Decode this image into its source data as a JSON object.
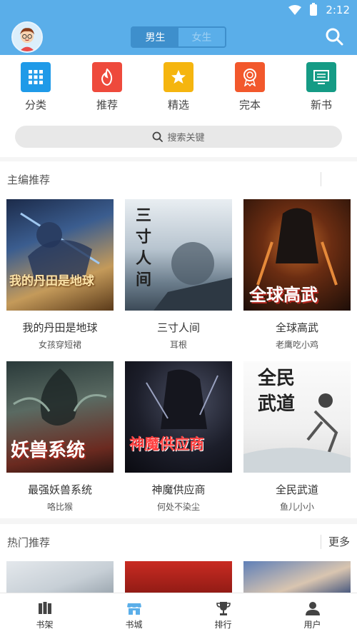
{
  "status": {
    "time": "2:12"
  },
  "header": {
    "segments": [
      {
        "label": "男生",
        "active": true
      },
      {
        "label": "女生",
        "active": false
      }
    ]
  },
  "categories": [
    {
      "label": "分类",
      "icon": "grid-icon",
      "color": "#1f9ae8"
    },
    {
      "label": "推荐",
      "icon": "flame-icon",
      "color": "#ee4a3c"
    },
    {
      "label": "精选",
      "icon": "star-icon",
      "color": "#f5b50f"
    },
    {
      "label": "完本",
      "icon": "medal-icon",
      "color": "#f2582c"
    },
    {
      "label": "新书",
      "icon": "monitor-icon",
      "color": "#159b85"
    }
  ],
  "search": {
    "placeholder": "搜索关键"
  },
  "editor_section": {
    "title": "主编推荐",
    "books": [
      {
        "title": "我的丹田是地球",
        "author": "女孩穿短裙",
        "cover_text": "我的丹田是地球"
      },
      {
        "title": "三寸人间",
        "author": "耳根",
        "cover_text": "三寸人间"
      },
      {
        "title": "全球高武",
        "author": "老鹰吃小鸡",
        "cover_text": "全球高武"
      },
      {
        "title": "最强妖兽系统",
        "author": "咯比猴",
        "cover_text": "妖兽系统"
      },
      {
        "title": "神魔供应商",
        "author": "何处不染尘",
        "cover_text": "神魔供应商"
      },
      {
        "title": "全民武道",
        "author": "鱼儿小小",
        "cover_text": "全民武道"
      }
    ]
  },
  "hot_section": {
    "title": "热门推荐",
    "more": "更多"
  },
  "tabbar": [
    {
      "label": "书架",
      "icon": "bookshelf-icon",
      "active": false
    },
    {
      "label": "书城",
      "icon": "store-icon",
      "active": true
    },
    {
      "label": "排行",
      "icon": "trophy-icon",
      "active": false
    },
    {
      "label": "用户",
      "icon": "user-icon",
      "active": false
    }
  ],
  "colors": {
    "primary": "#5aaee9",
    "segment_active": "#3e8fcc",
    "tab_active": "#5aaee9"
  }
}
